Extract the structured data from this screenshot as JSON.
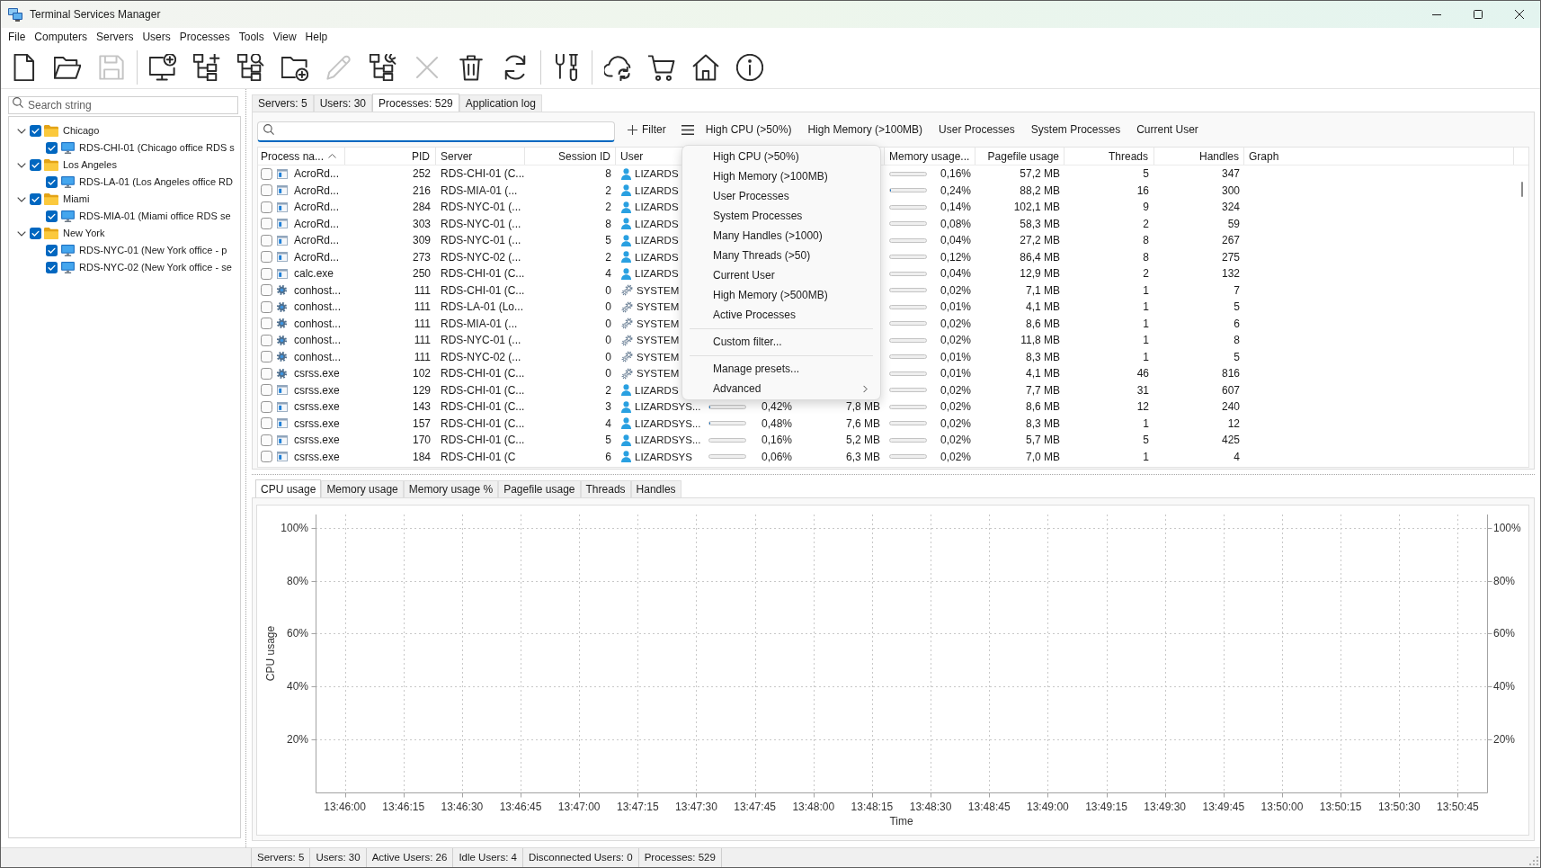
{
  "window": {
    "title": "Terminal Services Manager"
  },
  "menu": [
    "File",
    "Computers",
    "Servers",
    "Users",
    "Processes",
    "Tools",
    "View",
    "Help"
  ],
  "toolbar": [
    [
      {
        "disabled": false
      },
      {
        "disabled": false
      },
      {
        "disabled": true
      }
    ],
    [
      {
        "disabled": false
      },
      {
        "disabled": false
      },
      {
        "disabled": false
      },
      {
        "disabled": false
      },
      {
        "disabled": true
      },
      {
        "disabled": false
      },
      {
        "disabled": true
      },
      {
        "disabled": false
      },
      {
        "disabled": false
      }
    ],
    [
      {
        "disabled": false
      }
    ],
    [
      {
        "disabled": false
      },
      {
        "disabled": false
      },
      {
        "disabled": false
      },
      {
        "disabled": false
      }
    ]
  ],
  "sidebar": {
    "search": {
      "placeholder": "Search string"
    },
    "tree": [
      {
        "label": "Chicago",
        "kind": "folder",
        "checked": true,
        "expanded": true,
        "children": [
          {
            "label": "RDS-CHI-01 (Chicago office RDS s",
            "kind": "server",
            "checked": true
          }
        ]
      },
      {
        "label": "Los Angeles",
        "kind": "folder",
        "checked": true,
        "expanded": true,
        "children": [
          {
            "label": "RDS-LA-01 (Los Angeles office RD",
            "kind": "server",
            "checked": true
          }
        ]
      },
      {
        "label": "Miami",
        "kind": "folder",
        "checked": true,
        "expanded": true,
        "children": [
          {
            "label": "RDS-MIA-01 (Miami office RDS se",
            "kind": "server",
            "checked": true
          }
        ]
      },
      {
        "label": "New York",
        "kind": "folder",
        "checked": true,
        "expanded": true,
        "children": [
          {
            "label": "RDS-NYC-01 (New York office - p",
            "kind": "server",
            "checked": true
          },
          {
            "label": "RDS-NYC-02 (New York office - se",
            "kind": "server",
            "checked": true
          }
        ]
      }
    ]
  },
  "tabs": [
    {
      "label": "Servers: 5",
      "selected": false
    },
    {
      "label": "Users: 30",
      "selected": false
    },
    {
      "label": "Processes: 529",
      "selected": true
    },
    {
      "label": "Application log",
      "selected": false
    }
  ],
  "filter_bar": {
    "filter_button": "Filter",
    "presets": [
      "High CPU (>50%)",
      "High Memory (>100MB)",
      "User Processes",
      "System Processes",
      "Current User"
    ]
  },
  "preset_menu": [
    {
      "kind": "item",
      "label": "High CPU (>50%)"
    },
    {
      "kind": "item",
      "label": "High Memory (>100MB)"
    },
    {
      "kind": "item",
      "label": "User Processes"
    },
    {
      "kind": "item",
      "label": "System Processes"
    },
    {
      "kind": "item",
      "label": "Many Handles (>1000)"
    },
    {
      "kind": "item",
      "label": "Many Threads (>50)"
    },
    {
      "kind": "item",
      "label": "Current User"
    },
    {
      "kind": "item",
      "label": "High Memory (>500MB)"
    },
    {
      "kind": "item",
      "label": "Active Processes"
    },
    {
      "kind": "separator"
    },
    {
      "kind": "item",
      "label": "Custom filter..."
    },
    {
      "kind": "separator"
    },
    {
      "kind": "item",
      "label": "Manage presets..."
    },
    {
      "kind": "submenu",
      "label": "Advanced"
    }
  ],
  "table": {
    "columns": [
      {
        "label": "Process na...",
        "sorted": true
      },
      {
        "label": "PID"
      },
      {
        "label": "Server"
      },
      {
        "label": "Session ID"
      },
      {
        "label": "User"
      },
      {
        "label": "Memory usage..."
      },
      {
        "label": "Pagefile usage"
      },
      {
        "label": "Threads"
      },
      {
        "label": "Handles"
      },
      {
        "label": "Graph"
      }
    ],
    "rows": [
      {
        "checked": false,
        "kind": "app",
        "name": "AcroRd...",
        "pid": "252",
        "server": "RDS-CHI-01 (C...",
        "session": "8",
        "user": {
          "kind": "person",
          "name": "LIZARDS"
        },
        "memory_pct": {
          "level": 0.0016,
          "reading": "0,16%"
        },
        "pagefile": "57,2 MB",
        "threads": "5",
        "handles": "347"
      },
      {
        "checked": false,
        "kind": "app",
        "name": "AcroRd...",
        "pid": "216",
        "server": "RDS-MIA-01 (...",
        "session": "2",
        "user": {
          "kind": "person",
          "name": "LIZARDS"
        },
        "memory_pct": {
          "level": 0.0024,
          "reading": "0,24%"
        },
        "pagefile": "88,2 MB",
        "threads": "16",
        "handles": "300"
      },
      {
        "checked": false,
        "kind": "app",
        "name": "AcroRd...",
        "pid": "284",
        "server": "RDS-NYC-01 (...",
        "session": "2",
        "user": {
          "kind": "person",
          "name": "LIZARDS"
        },
        "memory_pct": {
          "level": 0.0014,
          "reading": "0,14%"
        },
        "pagefile": "102,1 MB",
        "threads": "9",
        "handles": "324"
      },
      {
        "checked": false,
        "kind": "app",
        "name": "AcroRd...",
        "pid": "303",
        "server": "RDS-NYC-01 (...",
        "session": "8",
        "user": {
          "kind": "person",
          "name": "LIZARDS"
        },
        "memory_pct": {
          "level": 0.0008,
          "reading": "0,08%"
        },
        "pagefile": "58,3 MB",
        "threads": "2",
        "handles": "59"
      },
      {
        "checked": false,
        "kind": "app",
        "name": "AcroRd...",
        "pid": "309",
        "server": "RDS-NYC-01 (...",
        "session": "5",
        "user": {
          "kind": "person",
          "name": "LIZARDS"
        },
        "memory_pct": {
          "level": 0.0004,
          "reading": "0,04%"
        },
        "pagefile": "27,2 MB",
        "threads": "8",
        "handles": "267"
      },
      {
        "checked": false,
        "kind": "app",
        "name": "AcroRd...",
        "pid": "273",
        "server": "RDS-NYC-02 (...",
        "session": "2",
        "user": {
          "kind": "person",
          "name": "LIZARDS"
        },
        "memory_pct": {
          "level": 0.0012,
          "reading": "0,12%"
        },
        "pagefile": "86,4 MB",
        "threads": "8",
        "handles": "275"
      },
      {
        "checked": false,
        "kind": "app",
        "name": "calc.exe",
        "pid": "250",
        "server": "RDS-CHI-01 (C...",
        "session": "4",
        "user": {
          "kind": "person",
          "name": "LIZARDS"
        },
        "memory_pct": {
          "level": 0.0004,
          "reading": "0,04%"
        },
        "pagefile": "12,9 MB",
        "threads": "2",
        "handles": "132"
      },
      {
        "checked": false,
        "kind": "service",
        "name": "conhost...",
        "pid": "111",
        "server": "RDS-CHI-01 (C...",
        "session": "0",
        "user": {
          "kind": "system",
          "name": "SYSTEM"
        },
        "memory_pct": {
          "level": 0.0002,
          "reading": "0,02%"
        },
        "pagefile": "7,1 MB",
        "threads": "1",
        "handles": "7"
      },
      {
        "checked": false,
        "kind": "service",
        "name": "conhost...",
        "pid": "111",
        "server": "RDS-LA-01 (Lo...",
        "session": "0",
        "user": {
          "kind": "system",
          "name": "SYSTEM"
        },
        "memory_pct": {
          "level": 0.0001,
          "reading": "0,01%"
        },
        "pagefile": "4,1 MB",
        "threads": "1",
        "handles": "5"
      },
      {
        "checked": false,
        "kind": "service",
        "name": "conhost...",
        "pid": "111",
        "server": "RDS-MIA-01 (...",
        "session": "0",
        "user": {
          "kind": "system",
          "name": "SYSTEM"
        },
        "memory_pct": {
          "level": 0.0002,
          "reading": "0,02%"
        },
        "pagefile": "8,6 MB",
        "threads": "1",
        "handles": "6"
      },
      {
        "checked": false,
        "kind": "service",
        "name": "conhost...",
        "pid": "111",
        "server": "RDS-NYC-01 (...",
        "session": "0",
        "user": {
          "kind": "system",
          "name": "SYSTEM"
        },
        "memory_pct": {
          "level": 0.0002,
          "reading": "0,02%"
        },
        "pagefile": "11,8 MB",
        "threads": "1",
        "handles": "8"
      },
      {
        "checked": false,
        "kind": "service",
        "name": "conhost...",
        "pid": "111",
        "server": "RDS-NYC-02 (...",
        "session": "0",
        "user": {
          "kind": "system",
          "name": "SYSTEM"
        },
        "memory_pct": {
          "level": 0.0001,
          "reading": "0,01%"
        },
        "pagefile": "8,3 MB",
        "threads": "1",
        "handles": "5"
      },
      {
        "checked": false,
        "kind": "service",
        "name": "csrss.exe",
        "pid": "102",
        "server": "RDS-CHI-01 (C...",
        "session": "0",
        "user": {
          "kind": "system",
          "name": "SYSTEM"
        },
        "memory_pct": {
          "level": 0.0001,
          "reading": "0,01%"
        },
        "pagefile": "4,1 MB",
        "threads": "46",
        "handles": "816"
      },
      {
        "checked": false,
        "kind": "app",
        "name": "csrss.exe",
        "pid": "129",
        "server": "RDS-CHI-01 (C...",
        "session": "2",
        "user": {
          "kind": "person",
          "name": "LIZARDS"
        },
        "memory_pct": {
          "level": 0.0002,
          "reading": "0,02%"
        },
        "pagefile": "7,7 MB",
        "threads": "31",
        "handles": "607"
      },
      {
        "checked": false,
        "kind": "app",
        "name": "csrss.exe",
        "pid": "143",
        "server": "RDS-CHI-01 (C...",
        "session": "3",
        "user": {
          "kind": "person",
          "name": "LIZARDSYS..."
        },
        "cpu": {
          "level": 0.0042,
          "reading": "0,42%"
        },
        "memory": "7,8 MB",
        "memory_pct": {
          "level": 0.0002,
          "reading": "0,02%"
        },
        "pagefile": "8,6 MB",
        "threads": "12",
        "handles": "240"
      },
      {
        "checked": false,
        "kind": "app",
        "name": "csrss.exe",
        "pid": "157",
        "server": "RDS-CHI-01 (C...",
        "session": "4",
        "user": {
          "kind": "person",
          "name": "LIZARDSYS..."
        },
        "cpu": {
          "level": 0.0048,
          "reading": "0,48%"
        },
        "memory": "7,6 MB",
        "memory_pct": {
          "level": 0.0002,
          "reading": "0,02%"
        },
        "pagefile": "8,3 MB",
        "threads": "1",
        "handles": "12"
      },
      {
        "checked": false,
        "kind": "app",
        "name": "csrss.exe",
        "pid": "170",
        "server": "RDS-CHI-01 (C...",
        "session": "5",
        "user": {
          "kind": "person",
          "name": "LIZARDSYS..."
        },
        "cpu": {
          "level": 0.0016,
          "reading": "0,16%"
        },
        "memory": "5,2 MB",
        "memory_pct": {
          "level": 0.0002,
          "reading": "0,02%"
        },
        "pagefile": "5,7 MB",
        "threads": "5",
        "handles": "425"
      },
      {
        "checked": false,
        "kind": "app",
        "name": "csrss.exe",
        "pid": "184",
        "server": "RDS-CHI-01 (C",
        "session": "6",
        "user": {
          "kind": "person",
          "name": "LIZARDSYS"
        },
        "cpu": {
          "level": 0.0006,
          "reading": "0,06%"
        },
        "memory": "6,3 MB",
        "memory_pct": {
          "level": 0.0002,
          "reading": "0,02%"
        },
        "pagefile": "7,0 MB",
        "threads": "1",
        "handles": "4"
      }
    ]
  },
  "chart_tabs": [
    {
      "label": "CPU usage",
      "selected": true
    },
    {
      "label": "Memory usage",
      "selected": false
    },
    {
      "label": "Memory usage %",
      "selected": false
    },
    {
      "label": "Pagefile usage",
      "selected": false
    },
    {
      "label": "Threads",
      "selected": false
    },
    {
      "label": "Handles",
      "selected": false
    }
  ],
  "chart_data": {
    "type": "line",
    "xlabel": "Time",
    "ylabel": "CPU usage",
    "categories": [
      "13:46:00",
      "13:46:15",
      "13:46:30",
      "13:46:45",
      "13:47:00",
      "13:47:15",
      "13:47:30",
      "13:47:45",
      "13:48:00",
      "13:48:15",
      "13:48:30",
      "13:48:45",
      "13:49:00",
      "13:49:15",
      "13:49:30",
      "13:49:45",
      "13:50:00",
      "13:50:15",
      "13:50:30",
      "13:50:45"
    ],
    "ylim": [
      0,
      105
    ],
    "yticks": [
      {
        "value": 20,
        "label": "20%"
      },
      {
        "value": 40,
        "label": "40%"
      },
      {
        "value": 60,
        "label": "60%"
      },
      {
        "value": 80,
        "label": "80%"
      },
      {
        "value": 100,
        "label": "100%"
      }
    ],
    "grid": true
  },
  "status_bar": [
    "Servers: 5",
    "Users: 30",
    "Active Users: 26",
    "Idle Users: 4",
    "Disconnected Users: 0",
    "Processes: 529"
  ]
}
